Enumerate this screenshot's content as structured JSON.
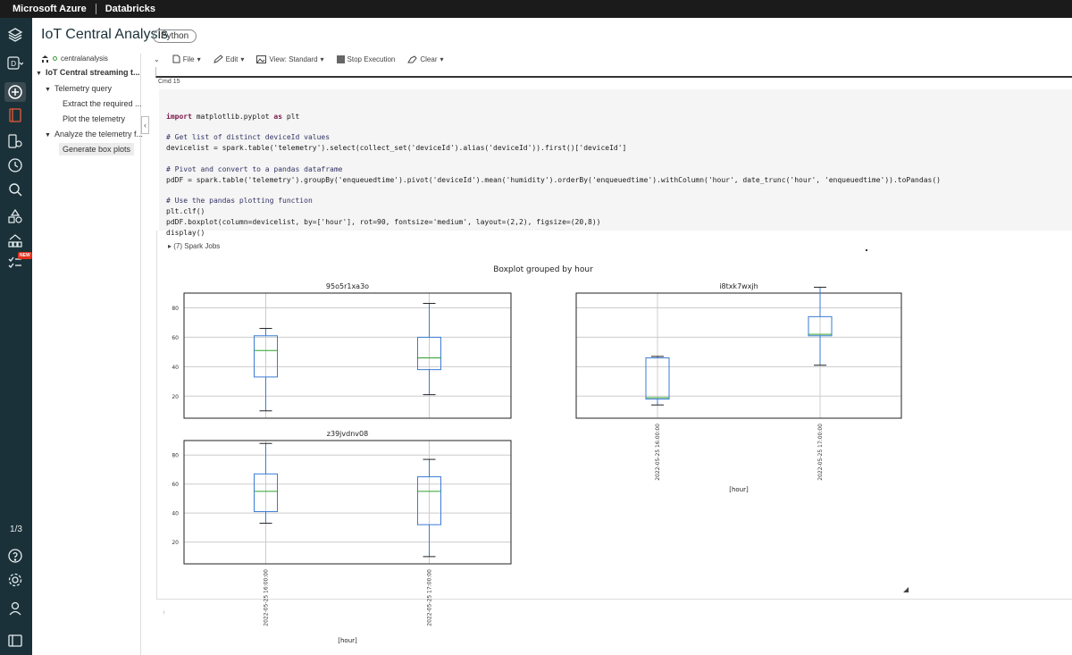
{
  "topbar": {
    "brand": "Microsoft Azure",
    "product": "Databricks"
  },
  "notebook": {
    "title": "IoT Central Analysis",
    "language": "Python",
    "cluster": "centralanalysis"
  },
  "toc": {
    "items": [
      {
        "label": "IoT Central streaming t...",
        "level": 0,
        "expanded": true
      },
      {
        "label": "Telemetry query",
        "level": 1,
        "expanded": true
      },
      {
        "label": "Extract the required ...",
        "level": 2
      },
      {
        "label": "Plot the telemetry",
        "level": 2
      },
      {
        "label": "Analyze the telemetry f...",
        "level": 1,
        "expanded": true
      },
      {
        "label": "Generate box plots",
        "level": 2,
        "selected": true
      }
    ]
  },
  "toolbar": {
    "file": "File",
    "edit": "Edit",
    "view": "View: Standard",
    "stop": "Stop Execution",
    "clear": "Clear"
  },
  "rail": {
    "page_count": "1/3",
    "new_badge": "NEW"
  },
  "cell": {
    "cmd_label": "Cmd 15",
    "code_lines": [
      "import matplotlib.pyplot as plt",
      "",
      "# Get list of distinct deviceId values",
      "devicelist = spark.table('telemetry').select(collect_set('deviceId').alias('deviceId')).first()['deviceId']",
      "",
      "# Pivot and convert to a pandas dataframe",
      "pdDF = spark.table('telemetry').groupBy('enqueuedtime').pivot('deviceId').mean('humidity').orderBy('enqueuedtime').withColumn('hour', date_trunc('hour', 'enqueuedtime')).toPandas()",
      "",
      "# Use the pandas plotting function",
      "plt.clf()",
      "pdDF.boxplot(column=devicelist, by=['hour'], rot=90, fontsize='medium', layout=(2,2), figsize=(20,8))",
      "display()"
    ],
    "spark_jobs": "(7) Spark Jobs"
  },
  "chart_data": {
    "type": "box",
    "title": "Boxplot grouped by hour",
    "xlabel": "[hour]",
    "categories": [
      "2022-05-25 16:00:00",
      "2022-05-25 17:00:00"
    ],
    "yticks": [
      20,
      40,
      60,
      80
    ],
    "subplots": [
      {
        "name": "95o5r1xa3o",
        "ylim": [
          5,
          90
        ],
        "boxes": [
          {
            "whislo": 10,
            "q1": 33,
            "med": 51,
            "q3": 61,
            "whishi": 66
          },
          {
            "whislo": 21,
            "q1": 38,
            "med": 46,
            "q3": 60,
            "whishi": 83
          }
        ]
      },
      {
        "name": "i8txk7wxjh",
        "ylim": [
          5,
          90
        ],
        "boxes": [
          {
            "whislo": 14,
            "q1": 18,
            "med": 19,
            "q3": 46,
            "whishi": 47
          },
          {
            "whislo": 41,
            "q1": 61,
            "med": 62,
            "q3": 74,
            "whishi": 94
          }
        ]
      },
      {
        "name": "z39jvdnv08",
        "ylim": [
          5,
          90
        ],
        "boxes": [
          {
            "whislo": 33,
            "q1": 41,
            "med": 55,
            "q3": 67,
            "whishi": 88
          },
          {
            "whislo": 10,
            "q1": 32,
            "med": 55,
            "q3": 65,
            "whishi": 77
          }
        ]
      }
    ],
    "colors": {
      "box": "#3a7bd5",
      "median": "#2ca02c",
      "whisker": "#3a7bd5",
      "cap": "#222222",
      "grid": "#cccccc"
    }
  }
}
